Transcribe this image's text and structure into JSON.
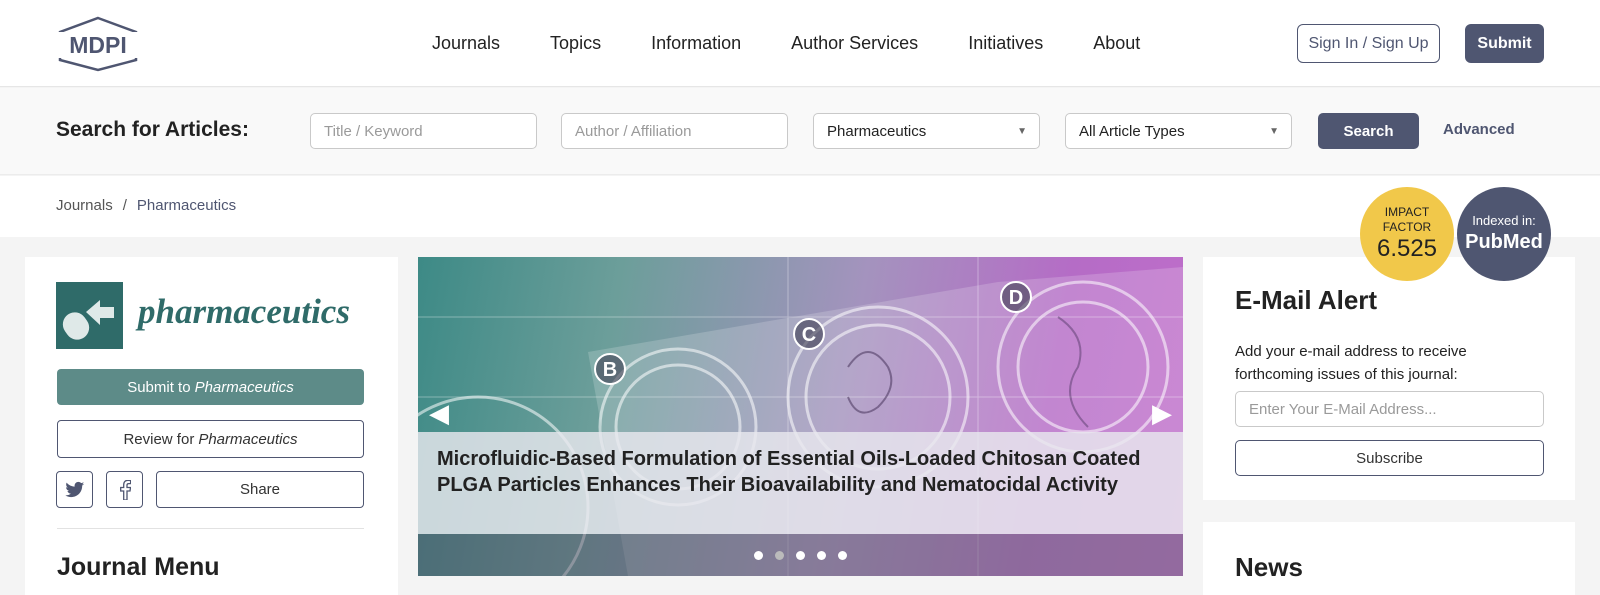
{
  "header": {
    "logo_text": "MDPI",
    "nav": [
      "Journals",
      "Topics",
      "Information",
      "Author Services",
      "Initiatives",
      "About"
    ],
    "signin_label": "Sign In / Sign Up",
    "submit_label": "Submit"
  },
  "search": {
    "label": "Search for Articles:",
    "title_placeholder": "Title / Keyword",
    "author_placeholder": "Author / Affiliation",
    "journal_selected": "Pharmaceutics",
    "type_selected": "All Article Types",
    "search_label": "Search",
    "advanced_label": "Advanced"
  },
  "breadcrumb": {
    "items": [
      "Journals",
      "Pharmaceutics"
    ],
    "separator": "/"
  },
  "badges": {
    "impact_line1": "IMPACT",
    "impact_line2": "FACTOR",
    "impact_value": "6.525",
    "indexed_label": "Indexed in:",
    "indexed_value": "PubMed"
  },
  "journal": {
    "name": "pharmaceutics",
    "submit_prefix": "Submit to",
    "review_prefix": "Review for",
    "journal_title": "Pharmaceutics",
    "share_label": "Share",
    "menu_title": "Journal Menu"
  },
  "carousel": {
    "caption": "Microfluidic-Based Formulation of Essential Oils-Loaded Chitosan Coated PLGA Particles Enhances Their Bioavailability and Nematocidal Activity",
    "labels": [
      "B",
      "C",
      "D"
    ],
    "slide_count": 5,
    "active_index": 1
  },
  "email_alert": {
    "title": "E-Mail Alert",
    "text": "Add your e-mail address to receive forthcoming issues of this journal:",
    "placeholder": "Enter Your E-Mail Address...",
    "subscribe_label": "Subscribe"
  },
  "news": {
    "title": "News"
  },
  "colors": {
    "brand": "#4f5671",
    "journal": "#2f6b69",
    "impact": "#f1c84a"
  }
}
